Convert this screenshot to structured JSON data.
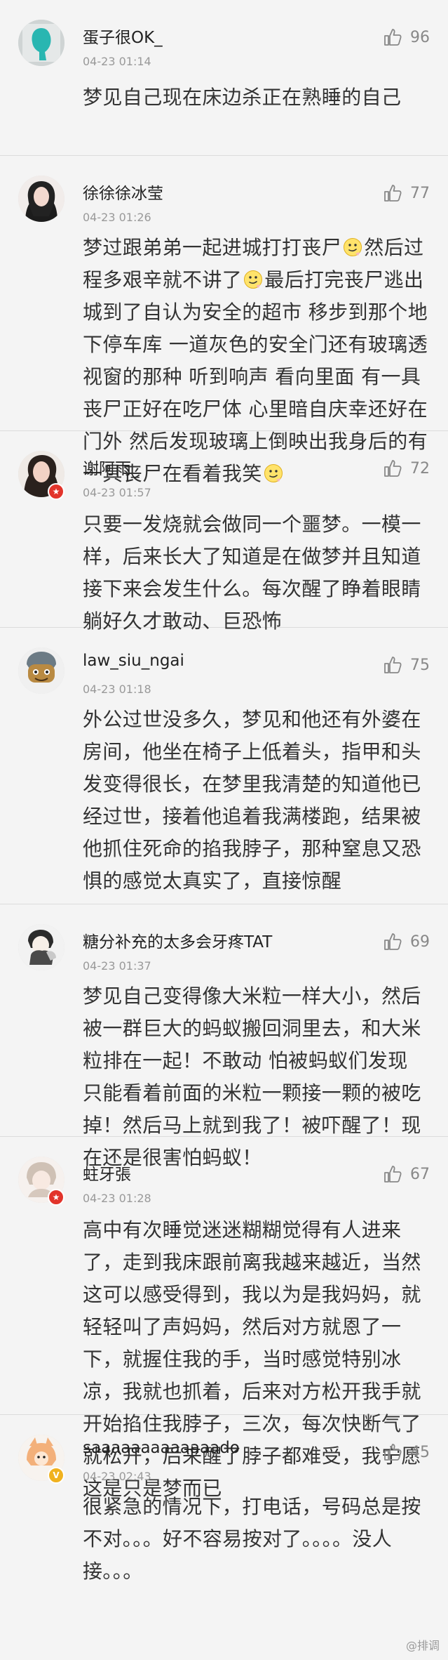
{
  "comments": [
    {
      "username": "蛋子很OK_",
      "time": "04-23 01:14",
      "likes": "96",
      "text_parts": [
        "梦见自己现在床边杀正在熟睡的自己"
      ]
    },
    {
      "username": "徐徐徐冰莹",
      "time": "04-23 01:26",
      "likes": "77",
      "text_parts": [
        "梦过跟弟弟一起进城打打丧尸",
        "然后过程多艰辛就不讲了",
        "最后打完丧尸逃出城到了自认为安全的超市 移步到那个地下停车库 一道灰色的安全门还有玻璃透视窗的那种 听到响声 看向里面 有一具丧尸正好在吃尸体 心里暗自庆幸还好在门外 然后发现玻璃上倒映出我身后的有一具丧尸在看着我笑",
        ""
      ]
    },
    {
      "username": "谢阿雨_",
      "time": "04-23 01:57",
      "likes": "72",
      "text_parts": [
        "只要一发烧就会做同一个噩梦。一模一样，后来长大了知道是在做梦并且知道接下来会发生什么。每次醒了睁着眼睛躺好久才敢动、巨恐怖"
      ]
    },
    {
      "username": "law_siu_ngai",
      "time": "04-23 01:18",
      "likes": "75",
      "text_parts": [
        "外公过世没多久，梦见和他还有外婆在房间，他坐在椅子上低着头，指甲和头发变得很长，在梦里我清楚的知道他已经过世，接着他追着我满楼跑，结果被他抓住死命的掐我脖子，那种窒息又恐惧的感觉太真实了，直接惊醒"
      ]
    },
    {
      "username": "糖分补充的太多会牙疼TAT",
      "time": "04-23 01:37",
      "likes": "69",
      "text_parts": [
        "梦见自己变得像大米粒一样大小，然后被一群巨大的蚂蚁搬回洞里去，和大米粒排在一起！不敢动 怕被蚂蚁们发现 只能看着前面的米粒一颗接一颗的被吃掉！然后马上就到我了！被吓醒了！现在还是很害怕蚂蚁！"
      ]
    },
    {
      "username": "蛀牙張",
      "time": "04-23 01:28",
      "likes": "67",
      "text_parts": [
        "高中有次睡觉迷迷糊糊觉得有人进来了，走到我床跟前离我越来越近，当然这可以感受得到，我以为是我妈妈，就轻轻叫了声妈妈，然后对方就恩了一下，就握住我的手，当时感觉特别冰凉，我就也抓着，后来对方松开我手就开始掐住我脖子，三次，每次快断气了就松开，后来醒了脖子都难受，我宁愿这是只是梦而已"
      ]
    },
    {
      "username": "saaaaaaaaaaaaado",
      "time": "04-23 02:43",
      "likes": "45",
      "text_parts": [
        "很紧急的情况下，打电话，号码总是按不对。。。好不容易按对了。。。。没人接。。。"
      ]
    }
  ],
  "watermark": "@排调",
  "badges": {
    "v_red_glyph": "★",
    "v_yellow_glyph": "V"
  },
  "colors": {
    "background": "#f4f4f4",
    "text": "#333333",
    "meta": "#999999",
    "badge_red": "#e2342b",
    "badge_yellow": "#f0b21f"
  },
  "icons": {
    "like": "thumbs-up-icon",
    "emoji": "smirk-emoji-icon"
  }
}
